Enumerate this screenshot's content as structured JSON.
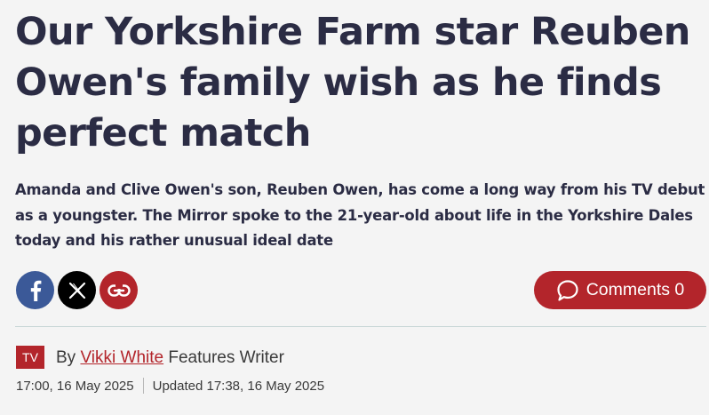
{
  "article": {
    "headline": "Our Yorkshire Farm star Reuben Owen's family wish as he finds perfect match",
    "standfirst": "Amanda and Clive Owen's son, Reuben Owen, has come a long way from his TV debut as a youngster. The Mirror spoke to the 21-year-old about life in the Yorkshire Dales today and his rather unusual ideal date"
  },
  "share": {
    "icons": [
      "facebook-icon",
      "x-icon",
      "link-icon"
    ]
  },
  "comments": {
    "label": "Comments",
    "count": "0",
    "icon": "speech-bubble-icon"
  },
  "byline": {
    "section_badge": "TV",
    "by": "By",
    "author": "Vikki White",
    "role": "Features Writer"
  },
  "dates": {
    "published": "17:00, 16 May 2025",
    "updated": "Updated 17:38, 16 May 2025"
  },
  "colors": {
    "accent": "#b3252b",
    "facebook": "#3b5998",
    "x": "#000000",
    "text": "#2b2c44",
    "background": "#f4f4f4"
  }
}
